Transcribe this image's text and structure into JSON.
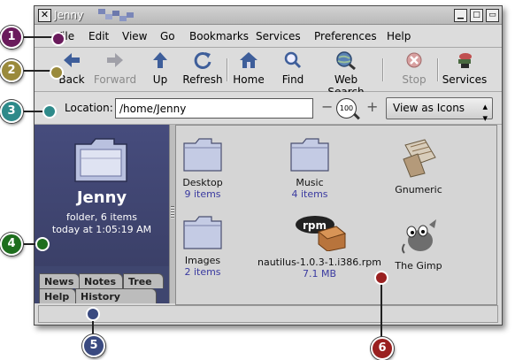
{
  "window": {
    "title": "Jenny"
  },
  "menubar": {
    "items": [
      "File",
      "Edit",
      "View",
      "Go",
      "Bookmarks",
      "Services",
      "Preferences",
      "Help"
    ]
  },
  "toolbar": {
    "back": "Back",
    "forward": "Forward",
    "up": "Up",
    "refresh": "Refresh",
    "home": "Home",
    "find": "Find",
    "web_search": "Web Search",
    "stop": "Stop",
    "services": "Services"
  },
  "location": {
    "label": "Location:",
    "value": "/home/Jenny",
    "zoom": "100",
    "view_mode": "View as Icons"
  },
  "sidebar": {
    "name": "Jenny",
    "description": "folder, 6 items",
    "modified": "today at 1:05:19 AM",
    "tabs": [
      "News",
      "Notes",
      "Tree",
      "Help",
      "History"
    ]
  },
  "files": [
    {
      "name": "Desktop",
      "count": "9 items",
      "icon": "folder-icon"
    },
    {
      "name": "Music",
      "count": "4 items",
      "icon": "folder-icon"
    },
    {
      "name": "Gnumeric",
      "count": "",
      "icon": "gnumeric-icon"
    },
    {
      "name": "Images",
      "count": "2 items",
      "icon": "folder-icon"
    },
    {
      "name": "nautilus-1.0.3-1.i386.rpm",
      "count": "7.1 MB",
      "icon": "rpm-package-icon"
    },
    {
      "name": "The Gimp",
      "count": "",
      "icon": "gimp-icon"
    }
  ],
  "callouts": [
    {
      "label": "1",
      "color": "#6a1b5c"
    },
    {
      "label": "2",
      "color": "#9a8a3c"
    },
    {
      "label": "3",
      "color": "#2e8a8a"
    },
    {
      "label": "4",
      "color": "#1e6e1e"
    },
    {
      "label": "5",
      "color": "#3a4a80"
    },
    {
      "label": "6",
      "color": "#9a2020"
    }
  ]
}
